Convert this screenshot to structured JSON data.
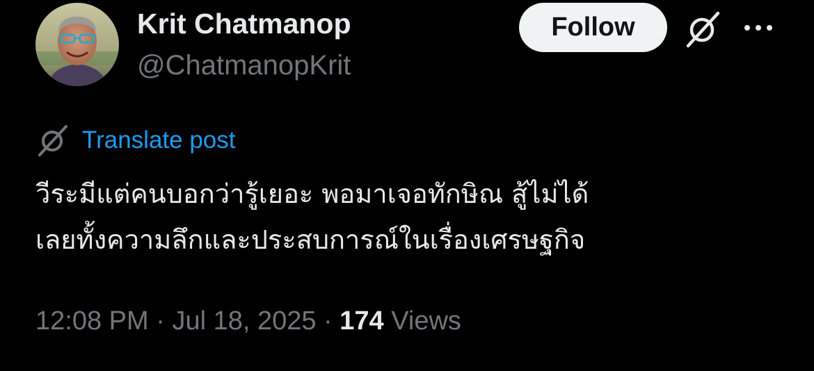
{
  "author": {
    "display_name": "Krit Chatmanop",
    "handle": "@ChatmanopKrit"
  },
  "actions": {
    "follow_label": "Follow",
    "grok_icon": "grok-slash-icon",
    "more_icon": "more-horizontal-icon"
  },
  "translate": {
    "icon": "grok-slash-icon",
    "label": "Translate post"
  },
  "post": {
    "lines": [
      "วีระมีแต่คนบอกว่ารู้เยอะ  พอมาเจอทักษิณ  สู้ไม่ได้",
      "เลยทั้งความลึกและประสบการณ์ในเรื่องเศรษฐกิจ"
    ]
  },
  "meta": {
    "time": "12:08 PM",
    "separator": " · ",
    "date": "Jul 18, 2025",
    "views_count": "174",
    "views_label": "Views"
  },
  "colors": {
    "background": "#000000",
    "primary_text": "#e7e9ea",
    "secondary_text": "#71767b",
    "link_blue": "#1d9bf0",
    "follow_bg": "#eff3f4",
    "follow_text": "#0f1419"
  }
}
